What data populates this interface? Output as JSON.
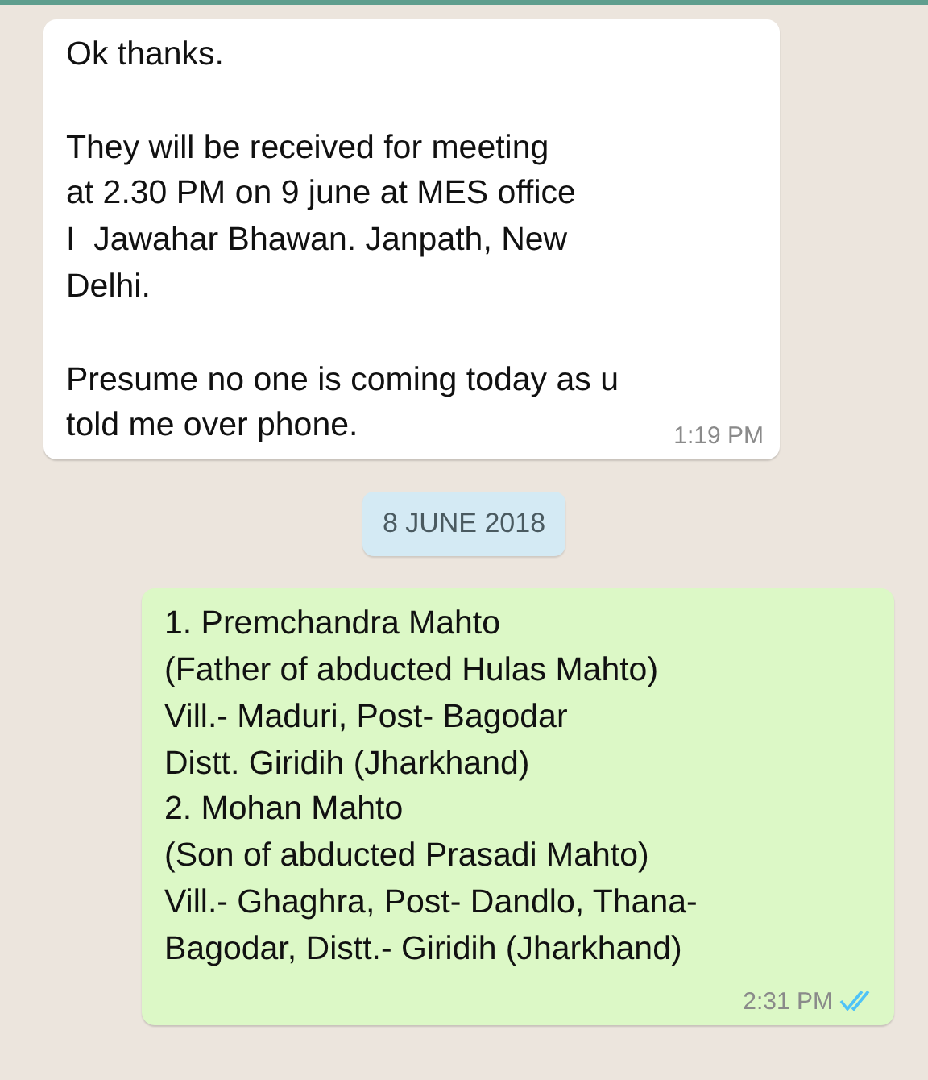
{
  "messages": [
    {
      "kind": "incoming",
      "text": "Ok thanks.\n\nThey will be received for meeting\nat 2.30 PM on 9 june at MES office\nI  Jawahar Bhawan. Janpath, New\nDelhi.\n\nPresume no one is coming today as u\ntold me over phone.",
      "time": "1:19 PM"
    },
    {
      "kind": "date",
      "text": "8 JUNE 2018"
    },
    {
      "kind": "outgoing",
      "text": "1. Premchandra Mahto\n(Father of abducted Hulas Mahto)\nVill.- Maduri, Post- Bagodar\nDistt. Giridih (Jharkhand)\n2. Mohan Mahto\n(Son of abducted Prasadi Mahto)\nVill.- Ghaghra, Post- Dandlo, Thana-\nBagodar, Distt.- Giridih (Jharkhand)",
      "time": "2:31 PM",
      "read": true
    }
  ]
}
